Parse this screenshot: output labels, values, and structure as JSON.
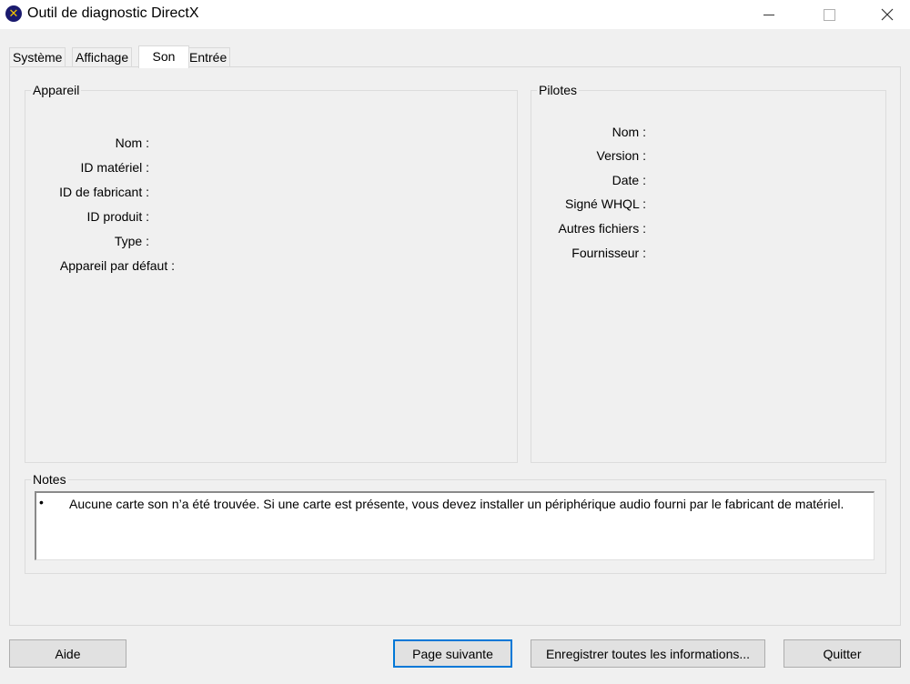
{
  "window": {
    "title": "Outil de diagnostic DirectX",
    "controls": {
      "minimize": "minimize-icon",
      "maximize": "maximize-icon",
      "close": "close-icon"
    }
  },
  "tabs": [
    {
      "label": "Système",
      "active": false
    },
    {
      "label": "Affichage",
      "active": false
    },
    {
      "label": "Son",
      "active": true
    },
    {
      "label": "Entrée",
      "active": false
    }
  ],
  "device": {
    "title": "Appareil",
    "fields": [
      {
        "label": "Nom :"
      },
      {
        "label": "ID matériel :"
      },
      {
        "label": "ID de fabricant :"
      },
      {
        "label": "ID produit :"
      },
      {
        "label": "Type :"
      },
      {
        "label": "Appareil par défaut :"
      }
    ]
  },
  "drivers": {
    "title": "Pilotes",
    "fields": [
      {
        "label": "Nom :"
      },
      {
        "label": "Version :"
      },
      {
        "label": "Date :"
      },
      {
        "label": "Signé WHQL :"
      },
      {
        "label": "Autres fichiers :"
      },
      {
        "label": "Fournisseur :"
      }
    ]
  },
  "notes": {
    "title": "Notes",
    "bullet": "•",
    "items": [
      "Aucune carte son n’a été trouvée. Si une carte est présente, vous devez installer un périphérique audio fourni par le fabricant de matériel."
    ]
  },
  "buttons": {
    "help": "Aide",
    "next_page": "Page suivante",
    "save_all": "Enregistrer toutes les informations...",
    "quit": "Quitter"
  },
  "colors": {
    "focus_border": "#0078d7",
    "icon_bg": "#1a1a6e",
    "icon_fg": "#f5c400"
  }
}
